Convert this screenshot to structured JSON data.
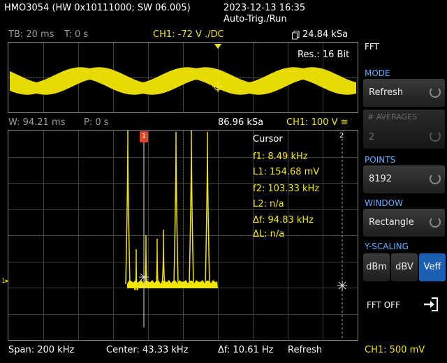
{
  "header": {
    "device": "HMO3054 (HW 0x10111000; SW 06.005)",
    "datetime": "2023-12-13 16:35",
    "mode": "Auto-Trig./Run"
  },
  "top_panel": {
    "timebase": "TB: 20 ms",
    "time_offset": "T: 0 s",
    "channel": "CH1: -72 V ./DC",
    "sample_rate": "24.84 kSa",
    "resolution": "Res.: 16 Bit"
  },
  "fft_info": {
    "window_width": "W: 94.21 ms",
    "position": "P: 0 s",
    "sample_rate": "86.96 kSa",
    "channel": "CH1: 100 V ≅"
  },
  "cursor": {
    "title": "Cursor",
    "f1": "f1: 8.49 kHz",
    "l1": "L1: 154.68 mV",
    "f2": "f2: 103.33 kHz",
    "l2": "L2: n/a",
    "df": "Δf: 94.83 kHz",
    "dl": "ΔL: n/a",
    "marker1": "1",
    "marker2": "2"
  },
  "bottom": {
    "span": "Span: 200 kHz",
    "center": "Center: 43.33 kHz",
    "delta_f": "Δf: 10.61 Hz",
    "refresh": "Refresh",
    "channel": "CH1: 500 mV"
  },
  "menu": {
    "title": "FFT",
    "mode_header": "MODE",
    "mode_value": "Refresh",
    "averages_header": "# AVERAGES",
    "averages_value": "2",
    "points_header": "POINTS",
    "points_value": "8192",
    "window_header": "WINDOW",
    "window_value": "Rectangle",
    "yscaling_header": "Y-SCALING",
    "yscaling_options": [
      "dBm",
      "dBV",
      "Veff"
    ],
    "yscaling_selected": "Veff",
    "fft_off": "FFT OFF"
  },
  "colors": {
    "trace": "#f2e600",
    "menu_header": "#5fb0ff",
    "selected": "#1a5fb4"
  }
}
